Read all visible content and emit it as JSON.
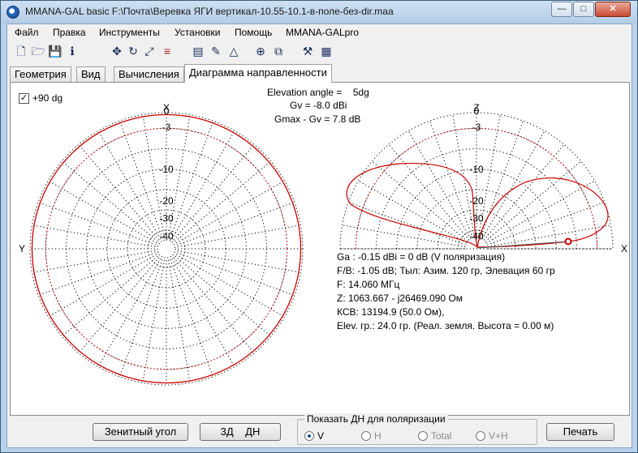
{
  "window": {
    "title": "MMANA-GAL basic F:\\Почта\\Веревка ЯГИ вертикал-10.55-10.1-в-поле-без-dir.maa",
    "buttons": {
      "minimize": "—",
      "maximize": "□",
      "close": "✕"
    }
  },
  "menu": [
    "Файл",
    "Правка",
    "Инструменты",
    "Установки",
    "Помощь",
    "MMANA-GALpro"
  ],
  "toolbar_icons": [
    "new-file-icon",
    "open-folder-icon",
    "save-icon",
    "info-icon",
    "move-icon",
    "rotate-icon",
    "scale-icon",
    "wire-edit-icon",
    "sheet-icon",
    "pencil-icon",
    "triangle-icon",
    "crosshair-icon",
    "copy-icon",
    "tools-icon",
    "calculator-icon"
  ],
  "tabs": [
    "Геометрия",
    "Вид",
    "Вычисления",
    "Диаграмма направленности"
  ],
  "active_tab": "Диаграмма направленности",
  "pattern": {
    "checkbox_label": "+90 dg",
    "checkbox_checked": true,
    "elevation_line": "Elevation angle =    5dg",
    "gv_line": "Gv = -8.0 dBi",
    "gmax_line": "Gmax - Gv = 7.8 dB",
    "ring_labels": [
      "0",
      "-3",
      "-10",
      "-20",
      "-30",
      "-40"
    ],
    "left_axis_top": "X",
    "left_axis_left": "Y",
    "right_axis_top": "Z",
    "right_axis_right": "X",
    "trace_color": "#cc0000",
    "grid_color": "#000000",
    "ref_ring_color": "#e00000"
  },
  "info": [
    "Ga : -0.15 dBi = 0 dB  (V поляризация)",
    "F/B: -1.05 dB; Тыл: Азим. 120 гр, Элевация 60 гр",
    "F: 14.060 МГц",
    "Z: 1063.667 - j26469.090 Ом",
    "КСВ: 13194.9 (50.0 Ом),",
    "Elev. гр.: 24.0 гр. (Реал. земля. Высота = 0.00 м)"
  ],
  "bottom": {
    "zenith_button": "Зенитный угол",
    "3d_button": "3Д    ДН",
    "group_title": "Показать ДН для поляризации",
    "radios": [
      "V",
      "H",
      "Total",
      "V+H"
    ],
    "selected_radio": "V",
    "print_button": "Печать"
  }
}
